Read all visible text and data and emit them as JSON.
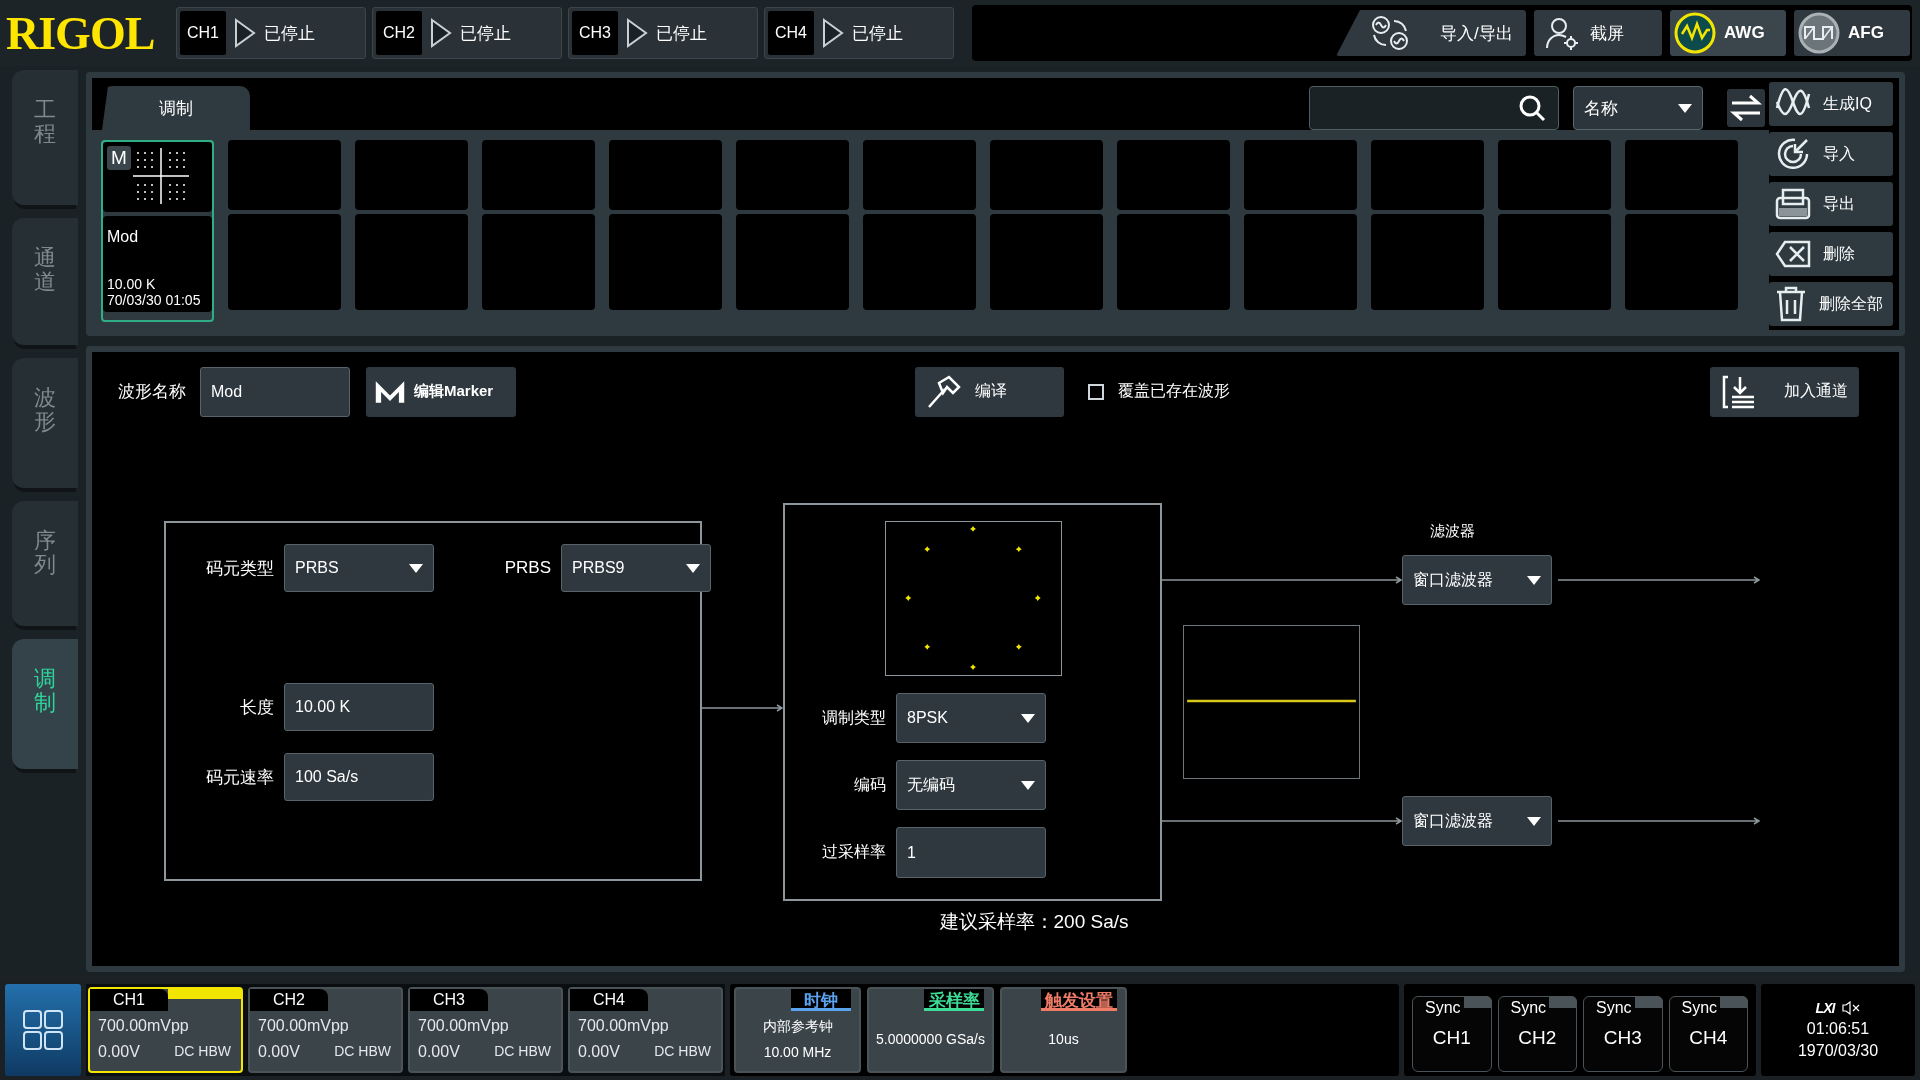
{
  "logo": "RIGOL",
  "channel_status": [
    {
      "label": "CH1",
      "state": "已停止"
    },
    {
      "label": "CH2",
      "state": "已停止"
    },
    {
      "label": "CH3",
      "state": "已停止"
    },
    {
      "label": "CH4",
      "state": "已停止"
    }
  ],
  "top_actions": [
    {
      "label": "导入/导出",
      "kind": "import_export",
      "selected": false
    },
    {
      "label": "截屏",
      "kind": "screenshot",
      "selected": false
    },
    {
      "label": "AWG",
      "kind": "awg",
      "selected": true
    },
    {
      "label": "AFG",
      "kind": "afg",
      "selected": false
    }
  ],
  "side_tabs": [
    {
      "label": "工程",
      "selected": false
    },
    {
      "label": "通道",
      "selected": false
    },
    {
      "label": "波形",
      "selected": false
    },
    {
      "label": "序列",
      "selected": false
    },
    {
      "label": "调制",
      "selected": true
    }
  ],
  "library": {
    "tabs": [
      {
        "label": "调制",
        "selected": true
      }
    ],
    "sort": "名称",
    "actions": [
      {
        "label": "生成IQ",
        "kind": "iq"
      },
      {
        "label": "导入",
        "kind": "import"
      },
      {
        "label": "导出",
        "kind": "export"
      },
      {
        "label": "删除",
        "kind": "delete"
      },
      {
        "label": "删除全部",
        "kind": "delete_all"
      }
    ],
    "items": [
      {
        "badge": "M",
        "name": "Mod",
        "size": "10.00 K",
        "date": "70/03/30 01:05",
        "selected": true
      }
    ]
  },
  "editor": {
    "name_label": "波形名称",
    "name": "Mod",
    "marker_button": "编辑Marker",
    "compile_button": "编译",
    "overwrite": {
      "label": "覆盖已存在波形",
      "checked": false
    },
    "add_channel_button": "加入通道",
    "source": [
      {
        "label": "码元类型",
        "value": "PRBS",
        "kind": "dropdown"
      },
      {
        "label": "PRBS",
        "value": "PRBS9",
        "kind": "dropdown"
      },
      {
        "label": "长度",
        "value": "10.00 K",
        "kind": "input"
      },
      {
        "label": "码元速率",
        "value": "100 Sa/s",
        "kind": "input"
      }
    ],
    "modulator": [
      {
        "label": "调制类型",
        "value": "8PSK",
        "kind": "dropdown"
      },
      {
        "label": "编码",
        "value": "无编码",
        "kind": "dropdown"
      },
      {
        "label": "过采样率",
        "value": "1",
        "kind": "input"
      }
    ],
    "suggested_rate": "建议采样率：200 Sa/s",
    "filter_label": "滤波器",
    "filters": [
      {
        "value": "窗口滤波器"
      },
      {
        "value": "窗口滤波器"
      }
    ]
  },
  "status_bar": {
    "channels": [
      {
        "label": "CH1",
        "amplitude": "700.00mVpp",
        "offset": "0.00V",
        "mode": "DC HBW",
        "selected": true
      },
      {
        "label": "CH2",
        "amplitude": "700.00mVpp",
        "offset": "0.00V",
        "mode": "DC HBW",
        "selected": false
      },
      {
        "label": "CH3",
        "amplitude": "700.00mVpp",
        "offset": "0.00V",
        "mode": "DC HBW",
        "selected": false
      },
      {
        "label": "CH4",
        "amplitude": "700.00mVpp",
        "offset": "0.00V",
        "mode": "DC HBW",
        "selected": false
      }
    ],
    "settings": [
      {
        "title": "时钟",
        "value": "内部参考钟",
        "detail": "10.00 MHz",
        "color": "#5aa2ee"
      },
      {
        "title": "采样率",
        "value": "5.0000000 GSa/s",
        "color": "#3ddc97"
      },
      {
        "title": "触发设置",
        "value": "10us",
        "color": "#f07c68"
      }
    ],
    "sync": [
      {
        "label": "Sync",
        "channel": "CH1"
      },
      {
        "label": "Sync",
        "channel": "CH2"
      },
      {
        "label": "Sync",
        "channel": "CH3"
      },
      {
        "label": "Sync",
        "channel": "CH4"
      }
    ],
    "lxi": "LXI",
    "time": "01:06:51",
    "date": "1970/03/30"
  }
}
